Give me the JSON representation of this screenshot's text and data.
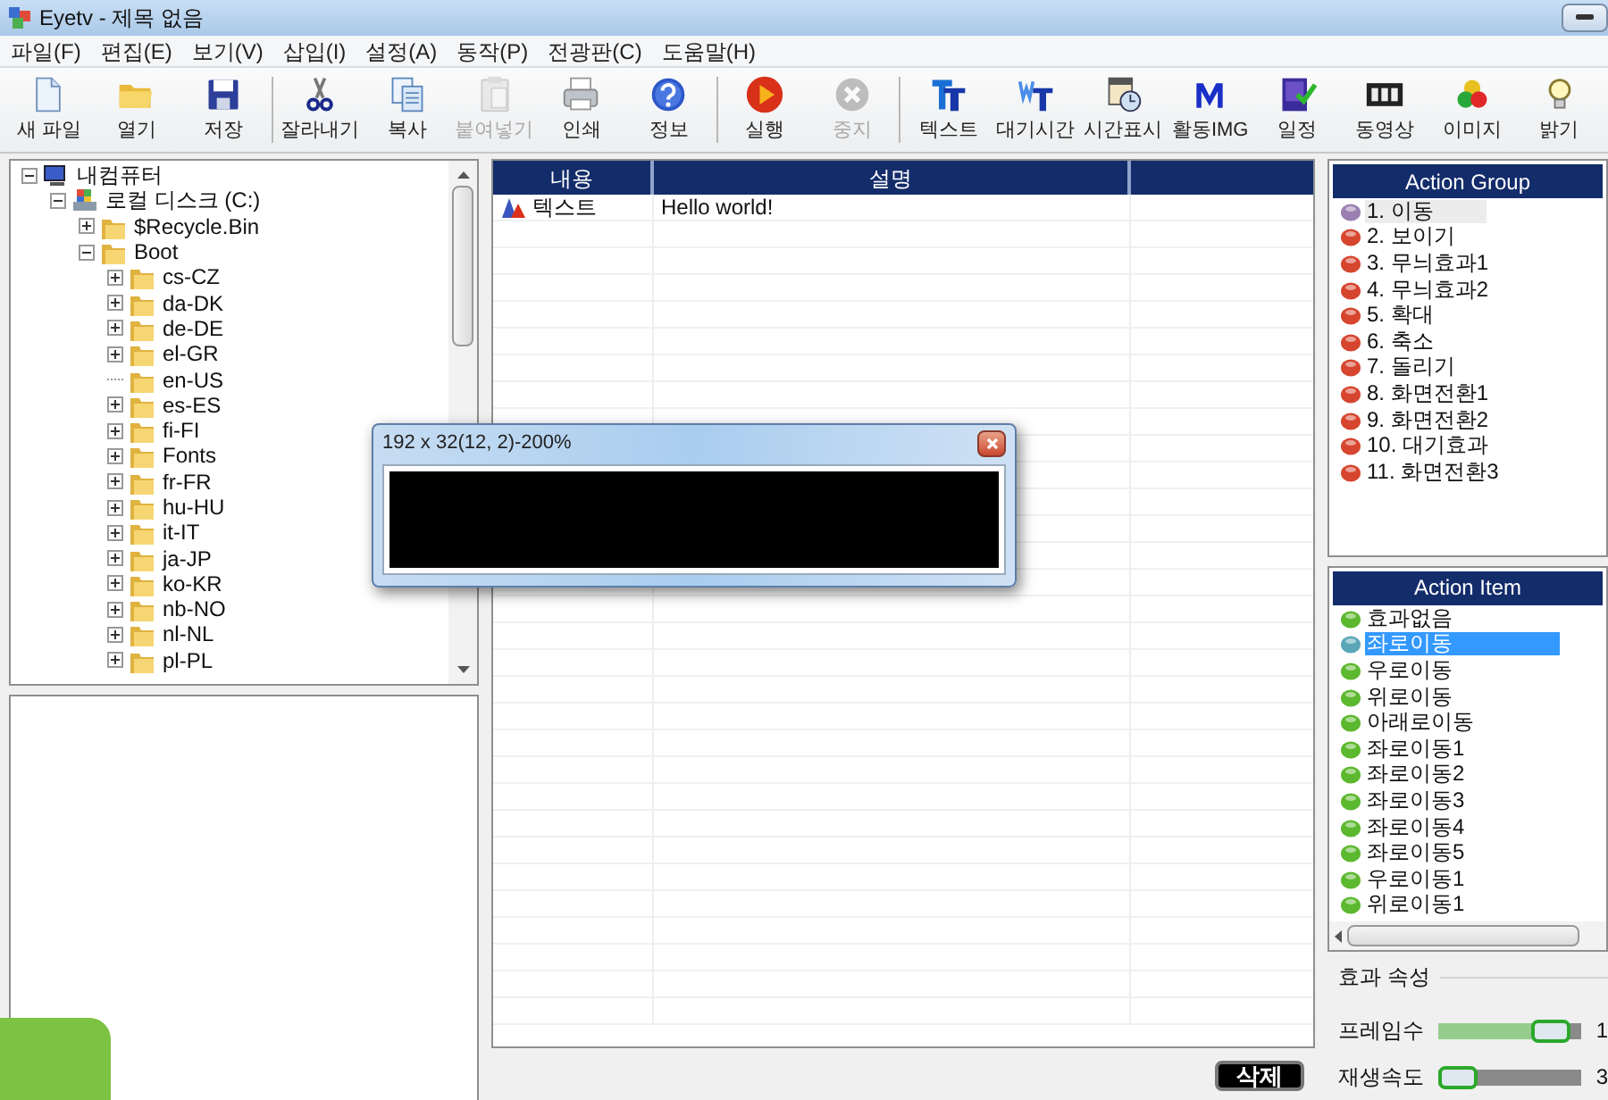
{
  "window": {
    "title": "Eyetv - 제목 없음"
  },
  "menu": [
    "파일(F)",
    "편집(E)",
    "보기(V)",
    "삽입(I)",
    "설정(A)",
    "동작(P)",
    "전광판(C)",
    "도움말(H)"
  ],
  "toolbar": {
    "groups": [
      [
        {
          "label": "새 파일",
          "disabled": false
        },
        {
          "label": "열기",
          "disabled": false
        },
        {
          "label": "저장",
          "disabled": false
        }
      ],
      [
        {
          "label": "잘라내기",
          "disabled": false
        },
        {
          "label": "복사",
          "disabled": false
        },
        {
          "label": "붙여넣기",
          "disabled": true
        },
        {
          "label": "인쇄",
          "disabled": false
        },
        {
          "label": "정보",
          "disabled": false
        }
      ],
      [
        {
          "label": "실행",
          "disabled": false
        },
        {
          "label": "중지",
          "disabled": true
        }
      ],
      [
        {
          "label": "텍스트",
          "disabled": false
        },
        {
          "label": "대기시간",
          "disabled": false
        },
        {
          "label": "시간표시",
          "disabled": false
        },
        {
          "label": "활동IMG",
          "disabled": false
        },
        {
          "label": "일정",
          "disabled": false
        },
        {
          "label": "동영상",
          "disabled": false
        },
        {
          "label": "이미지",
          "disabled": false
        },
        {
          "label": "밝기",
          "disabled": false
        }
      ]
    ]
  },
  "tree": [
    {
      "label": "내컴퓨터",
      "kind": "computer",
      "expanded": true,
      "children": [
        {
          "label": "로컬 디스크 (C:)",
          "kind": "drive",
          "expanded": true,
          "children": [
            {
              "label": "$Recycle.Bin",
              "kind": "folder",
              "expanded": false
            },
            {
              "label": "Boot",
              "kind": "folder",
              "expanded": true,
              "children": [
                {
                  "label": "cs-CZ",
                  "kind": "folder",
                  "expanded": false
                },
                {
                  "label": "da-DK",
                  "kind": "folder",
                  "expanded": false
                },
                {
                  "label": "de-DE",
                  "kind": "folder",
                  "expanded": false
                },
                {
                  "label": "el-GR",
                  "kind": "folder",
                  "expanded": false
                },
                {
                  "label": "en-US",
                  "kind": "folder"
                },
                {
                  "label": "es-ES",
                  "kind": "folder",
                  "expanded": false
                },
                {
                  "label": "fi-FI",
                  "kind": "folder",
                  "expanded": false
                },
                {
                  "label": "Fonts",
                  "kind": "folder",
                  "expanded": false
                },
                {
                  "label": "fr-FR",
                  "kind": "folder",
                  "expanded": false
                },
                {
                  "label": "hu-HU",
                  "kind": "folder",
                  "expanded": false
                },
                {
                  "label": "it-IT",
                  "kind": "folder",
                  "expanded": false
                },
                {
                  "label": "ja-JP",
                  "kind": "folder",
                  "expanded": false
                },
                {
                  "label": "ko-KR",
                  "kind": "folder",
                  "expanded": false
                },
                {
                  "label": "nb-NO",
                  "kind": "folder",
                  "expanded": false
                },
                {
                  "label": "nl-NL",
                  "kind": "folder",
                  "expanded": false
                },
                {
                  "label": "pl-PL",
                  "kind": "folder",
                  "expanded": false
                }
              ]
            }
          ]
        }
      ]
    }
  ],
  "table": {
    "columns": [
      "내용",
      "설명"
    ],
    "rows": [
      {
        "cells": [
          "텍스트",
          "Hello world!"
        ]
      }
    ]
  },
  "delete_button": "삭제",
  "preview_dialog": {
    "title": "192 x 32(12, 2)-200%"
  },
  "action_group": {
    "title": "Action Group",
    "items": [
      {
        "label": "1. 이동",
        "selected": true
      },
      {
        "label": "2. 보이기",
        "selected": false
      },
      {
        "label": "3. 무늬효과1",
        "selected": false
      },
      {
        "label": "4. 무늬효과2",
        "selected": false
      },
      {
        "label": "5. 확대",
        "selected": false
      },
      {
        "label": "6. 축소",
        "selected": false
      },
      {
        "label": "7. 돌리기",
        "selected": false
      },
      {
        "label": "8. 화면전환1",
        "selected": false
      },
      {
        "label": "9. 화면전환2",
        "selected": false
      },
      {
        "label": "10. 대기효과",
        "selected": false
      },
      {
        "label": "11. 화면전환3",
        "selected": false
      }
    ]
  },
  "action_item": {
    "title": "Action Item",
    "items": [
      {
        "label": "효과없음",
        "selected": false
      },
      {
        "label": "좌로이동",
        "selected": true
      },
      {
        "label": "우로이동",
        "selected": false
      },
      {
        "label": "위로이동",
        "selected": false
      },
      {
        "label": "아래로이동",
        "selected": false
      },
      {
        "label": "좌로이동1",
        "selected": false
      },
      {
        "label": "좌로이동2",
        "selected": false
      },
      {
        "label": "좌로이동3",
        "selected": false
      },
      {
        "label": "좌로이동4",
        "selected": false
      },
      {
        "label": "좌로이동5",
        "selected": false
      },
      {
        "label": "우로이동1",
        "selected": false
      },
      {
        "label": "위로이동1",
        "selected": false
      }
    ]
  },
  "effect_properties": {
    "title": "효과 속성",
    "sliders": [
      {
        "label": "프레임수",
        "level": 0.68,
        "reading": "1"
      },
      {
        "label": "재생속도",
        "level": 0.1,
        "reading": "3"
      }
    ]
  }
}
